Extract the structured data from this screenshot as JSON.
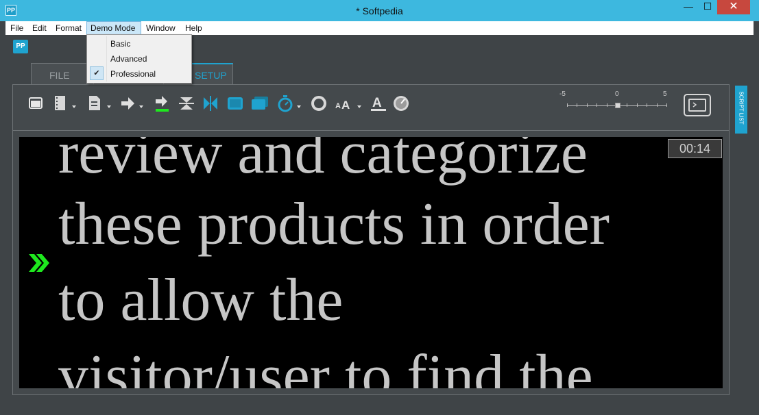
{
  "window": {
    "title": "* Softpedia",
    "app_icon": "PP",
    "minimize": "—",
    "maximize": "☐",
    "close": "✕"
  },
  "menubar": {
    "items": [
      "File",
      "Edit",
      "Format",
      "Demo Mode",
      "Window",
      "Help"
    ]
  },
  "demo_mode_menu": {
    "items": [
      "Basic",
      "Advanced",
      "Professional"
    ],
    "checked": "Professional"
  },
  "app": {
    "logo": "PP",
    "tabs": [
      {
        "label": "FILE",
        "active": false
      },
      {
        "label": "SETUP",
        "active": true
      }
    ]
  },
  "toolbar": {
    "icons": [
      "window-icon",
      "document-icon",
      "script-icon",
      "arrow-right-icon",
      "arrow-cue-icon",
      "flip-vertical-icon",
      "flip-horizontal-icon",
      "display-icon",
      "layers-icon",
      "timer-icon",
      "ring-icon",
      "font-size-icon",
      "font-color-icon",
      "speed-gauge-icon"
    ],
    "speed_labels": [
      "-5",
      "0",
      "5"
    ],
    "speed_value": 0,
    "accent_color": "#1fa3cf",
    "cue_color": "#1ee81e"
  },
  "prompter": {
    "lines": [
      "review and categorize",
      "these products in order",
      "to allow the",
      "visitor/user to find the"
    ],
    "timer": "00:14",
    "text_color": "#c6c6c6",
    "background": "#000000"
  },
  "sidebar": {
    "script_list_label": "SCRIPT LIST"
  }
}
